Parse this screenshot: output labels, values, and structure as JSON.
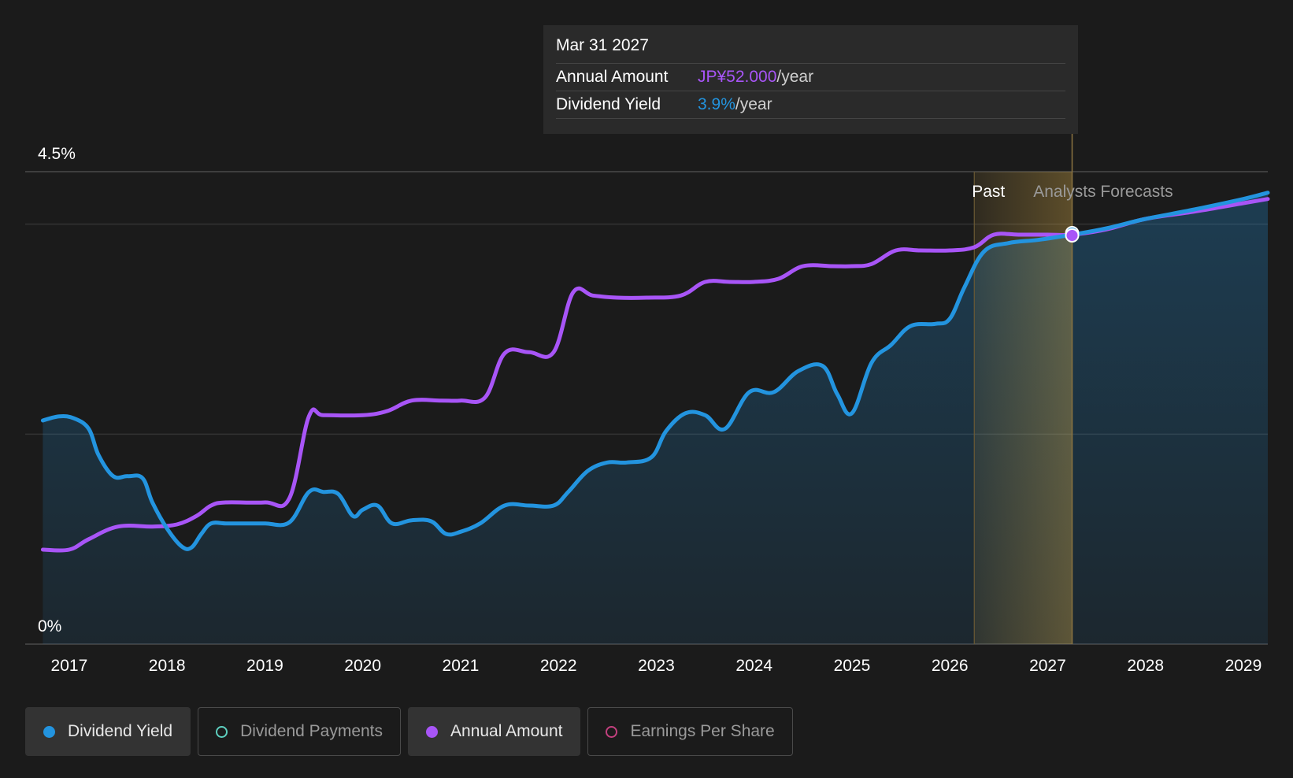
{
  "tooltip": {
    "date": "Mar 31 2027",
    "annual_amount_label": "Annual Amount",
    "annual_amount_value": "JP¥52.000",
    "dividend_yield_label": "Dividend Yield",
    "dividend_yield_value": "3.9%",
    "unit": "/year"
  },
  "zones": {
    "past": "Past",
    "forecast": "Analysts Forecasts"
  },
  "legend": [
    {
      "label": "Dividend Yield",
      "color": "#2394df",
      "active": true,
      "filled": true
    },
    {
      "label": "Dividend Payments",
      "color": "#5dcfbf",
      "active": false,
      "filled": false
    },
    {
      "label": "Annual Amount",
      "color": "#a855f7",
      "active": true,
      "filled": true
    },
    {
      "label": "Earnings Per Share",
      "color": "#c2407e",
      "active": false,
      "filled": false
    }
  ],
  "colors": {
    "yield": "#2394df",
    "amount": "#a855f7",
    "background": "#1b1b1b",
    "highlight": "#e8b84a"
  },
  "chart_data": {
    "type": "line",
    "y_tick_labels": [
      "4.5%",
      "0%"
    ],
    "ylim": [
      0,
      4.5
    ],
    "x_tick_labels": [
      "2017",
      "2018",
      "2019",
      "2020",
      "2021",
      "2022",
      "2023",
      "2024",
      "2025",
      "2026",
      "2027",
      "2028",
      "2029"
    ],
    "xlim": [
      2016.55,
      2029.25
    ],
    "past_end": 2026.25,
    "highlight_date": 2027.25,
    "grid": true,
    "series": [
      {
        "name": "Dividend Yield",
        "unit": "%",
        "points": [
          [
            2016.73,
            2.13
          ],
          [
            2016.9,
            2.17
          ],
          [
            2017.05,
            2.15
          ],
          [
            2017.2,
            2.05
          ],
          [
            2017.3,
            1.8
          ],
          [
            2017.45,
            1.6
          ],
          [
            2017.6,
            1.6
          ],
          [
            2017.75,
            1.58
          ],
          [
            2017.85,
            1.35
          ],
          [
            2018.0,
            1.1
          ],
          [
            2018.15,
            0.93
          ],
          [
            2018.25,
            0.92
          ],
          [
            2018.35,
            1.05
          ],
          [
            2018.45,
            1.15
          ],
          [
            2018.6,
            1.15
          ],
          [
            2018.8,
            1.15
          ],
          [
            2019.0,
            1.15
          ],
          [
            2019.25,
            1.16
          ],
          [
            2019.45,
            1.45
          ],
          [
            2019.6,
            1.45
          ],
          [
            2019.75,
            1.43
          ],
          [
            2019.9,
            1.22
          ],
          [
            2020.0,
            1.28
          ],
          [
            2020.15,
            1.32
          ],
          [
            2020.3,
            1.15
          ],
          [
            2020.5,
            1.18
          ],
          [
            2020.7,
            1.17
          ],
          [
            2020.85,
            1.05
          ],
          [
            2021.0,
            1.07
          ],
          [
            2021.2,
            1.15
          ],
          [
            2021.45,
            1.32
          ],
          [
            2021.7,
            1.32
          ],
          [
            2021.95,
            1.32
          ],
          [
            2022.1,
            1.45
          ],
          [
            2022.3,
            1.65
          ],
          [
            2022.5,
            1.73
          ],
          [
            2022.7,
            1.73
          ],
          [
            2022.95,
            1.78
          ],
          [
            2023.1,
            2.03
          ],
          [
            2023.3,
            2.2
          ],
          [
            2023.5,
            2.18
          ],
          [
            2023.7,
            2.05
          ],
          [
            2023.95,
            2.4
          ],
          [
            2024.2,
            2.4
          ],
          [
            2024.45,
            2.6
          ],
          [
            2024.7,
            2.65
          ],
          [
            2024.85,
            2.38
          ],
          [
            2025.0,
            2.2
          ],
          [
            2025.2,
            2.68
          ],
          [
            2025.4,
            2.85
          ],
          [
            2025.6,
            3.03
          ],
          [
            2025.85,
            3.05
          ],
          [
            2026.0,
            3.1
          ],
          [
            2026.15,
            3.4
          ],
          [
            2026.35,
            3.74
          ],
          [
            2026.6,
            3.82
          ],
          [
            2026.9,
            3.85
          ],
          [
            2027.25,
            3.9
          ],
          [
            2027.6,
            3.96
          ],
          [
            2028.0,
            4.05
          ],
          [
            2028.5,
            4.14
          ],
          [
            2029.0,
            4.24
          ],
          [
            2029.25,
            4.3
          ]
        ]
      },
      {
        "name": "Annual Amount",
        "unit": "JP¥/year",
        "points": [
          [
            2016.73,
            0.9
          ],
          [
            2017.0,
            0.9
          ],
          [
            2017.2,
            1.0
          ],
          [
            2017.5,
            1.12
          ],
          [
            2017.85,
            1.12
          ],
          [
            2018.1,
            1.14
          ],
          [
            2018.3,
            1.22
          ],
          [
            2018.45,
            1.32
          ],
          [
            2018.6,
            1.35
          ],
          [
            2019.0,
            1.35
          ],
          [
            2019.25,
            1.39
          ],
          [
            2019.45,
            2.17
          ],
          [
            2019.6,
            2.18
          ],
          [
            2020.0,
            2.18
          ],
          [
            2020.25,
            2.22
          ],
          [
            2020.5,
            2.32
          ],
          [
            2020.8,
            2.32
          ],
          [
            2021.0,
            2.32
          ],
          [
            2021.25,
            2.35
          ],
          [
            2021.45,
            2.77
          ],
          [
            2021.7,
            2.78
          ],
          [
            2021.95,
            2.78
          ],
          [
            2022.15,
            3.35
          ],
          [
            2022.35,
            3.32
          ],
          [
            2022.6,
            3.3
          ],
          [
            2022.9,
            3.3
          ],
          [
            2023.25,
            3.32
          ],
          [
            2023.5,
            3.45
          ],
          [
            2023.75,
            3.45
          ],
          [
            2024.0,
            3.45
          ],
          [
            2024.25,
            3.48
          ],
          [
            2024.5,
            3.6
          ],
          [
            2024.8,
            3.6
          ],
          [
            2025.0,
            3.6
          ],
          [
            2025.2,
            3.62
          ],
          [
            2025.45,
            3.75
          ],
          [
            2025.7,
            3.75
          ],
          [
            2026.0,
            3.75
          ],
          [
            2026.25,
            3.78
          ],
          [
            2026.45,
            3.9
          ],
          [
            2026.7,
            3.9
          ],
          [
            2027.0,
            3.9
          ],
          [
            2027.25,
            3.9
          ],
          [
            2027.6,
            3.95
          ],
          [
            2028.0,
            4.05
          ],
          [
            2028.5,
            4.12
          ],
          [
            2029.0,
            4.2
          ],
          [
            2029.25,
            4.24
          ]
        ]
      }
    ]
  }
}
